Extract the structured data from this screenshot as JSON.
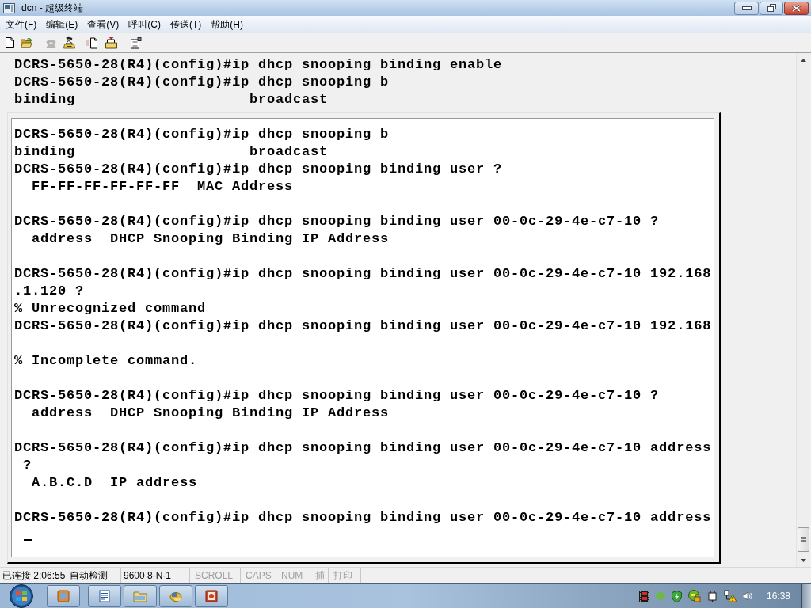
{
  "window": {
    "title": "dcn - 超级终端"
  },
  "menu_bar": [
    {
      "label": "文件(F)"
    },
    {
      "label": "编辑(E)"
    },
    {
      "label": "查看(V)"
    },
    {
      "label": "呼叫(C)"
    },
    {
      "label": "传送(T)"
    },
    {
      "label": "帮助(H)"
    }
  ],
  "toolbar": [
    {
      "disabled": false
    },
    {
      "disabled": false
    },
    {
      "disabled": true
    },
    {
      "disabled": false
    },
    {
      "disabled": false
    },
    {
      "disabled": false
    },
    {
      "disabled": false
    }
  ],
  "terminal": {
    "lines": [
      "DCRS-5650-28(R4)(config)#ip dhcp snooping binding enable",
      "DCRS-5650-28(R4)(config)#ip dhcp snooping b",
      "binding                    broadcast"
    ],
    "panel": {
      "blocks": [
        [
          "DCRS-5650-28(R4)(config)#ip dhcp snooping b",
          "binding                    broadcast",
          "DCRS-5650-28(R4)(config)#ip dhcp snooping binding user ?",
          "  FF-FF-FF-FF-FF-FF  MAC Address"
        ],
        [
          "DCRS-5650-28(R4)(config)#ip dhcp snooping binding user 00-0c-29-4e-c7-10 ?",
          "  address  DHCP Snooping Binding IP Address"
        ],
        [
          "DCRS-5650-28(R4)(config)#ip dhcp snooping binding user 00-0c-29-4e-c7-10 192.168",
          ".1.120 ?",
          "% Unrecognized command",
          "DCRS-5650-28(R4)(config)#ip dhcp snooping binding user 00-0c-29-4e-c7-10 192.168"
        ],
        [
          "% Incomplete command."
        ],
        [
          "DCRS-5650-28(R4)(config)#ip dhcp snooping binding user 00-0c-29-4e-c7-10 ?",
          "  address  DHCP Snooping Binding IP Address"
        ],
        [
          "DCRS-5650-28(R4)(config)#ip dhcp snooping binding user 00-0c-29-4e-c7-10 address",
          " ?",
          "  A.B.C.D  IP address"
        ],
        [
          "DCRS-5650-28(R4)(config)#ip dhcp snooping binding user 00-0c-29-4e-c7-10 address"
        ]
      ]
    }
  },
  "status_bar": {
    "connection": "已连接 2:06:55",
    "detection": "自动检测",
    "port_settings": "9600 8-N-1",
    "indicators": [
      {
        "label": "SCROLL",
        "on": false
      },
      {
        "label": "CAPS",
        "on": false
      },
      {
        "label": "NUM",
        "on": false
      },
      {
        "label": "捕",
        "on": false
      },
      {
        "label": "打印",
        "on": false
      }
    ]
  },
  "taskbar": {
    "clock": "16:38"
  }
}
